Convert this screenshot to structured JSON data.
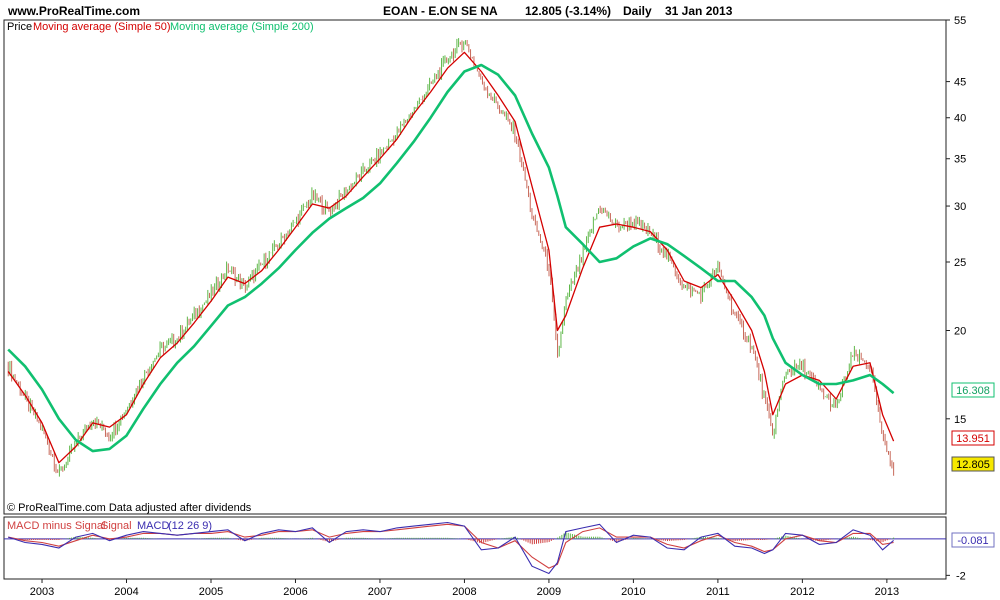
{
  "header": {
    "site": "www.ProRealTime.com",
    "instrument": "EOAN - E.ON SE NA",
    "last": "12.805 (-3.14%)",
    "period": "Daily",
    "date": "31 Jan 2013"
  },
  "price_panel": {
    "legend_price": "Price",
    "legend_ma50": "Moving average (Simple 50)",
    "legend_ma200": "Moving average (Simple 200)",
    "footer": "© ProRealTime.com  Data adjusted after dividends",
    "badges": {
      "ma200": "16.308",
      "ma50": "13.951",
      "price": "12.805"
    }
  },
  "macd_panel": {
    "legend_hist": "MACD minus Signal",
    "legend_signal": "Signal",
    "legend_macd": "MACD",
    "legend_params": "(12 26 9)",
    "badge": "-0.081"
  },
  "colors": {
    "candle_up": "#5fb84a",
    "candle_down": "#c8695a",
    "ma50": "#d40000",
    "ma200": "#10c070",
    "macd": "#3a2db0",
    "signal": "#d04040",
    "price_badge": "#f6e800",
    "zero_line": "#3a2db0"
  },
  "chart_data": [
    {
      "type": "line",
      "title": "EOAN - E.ON SE NA",
      "scale": "log",
      "ylim": [
        11,
        55
      ],
      "y_ticks": [
        15,
        20,
        25,
        30,
        35,
        40,
        45,
        55
      ],
      "x_ticks": [
        "2003",
        "2004",
        "2005",
        "2006",
        "2007",
        "2008",
        "2009",
        "2010",
        "2011",
        "2012",
        "2013"
      ],
      "x": [
        2002.6,
        2002.8,
        2003.0,
        2003.2,
        2003.4,
        2003.6,
        2003.8,
        2004.0,
        2004.2,
        2004.4,
        2004.6,
        2004.8,
        2005.0,
        2005.2,
        2005.4,
        2005.6,
        2005.8,
        2006.0,
        2006.2,
        2006.4,
        2006.6,
        2006.8,
        2007.0,
        2007.2,
        2007.4,
        2007.6,
        2007.8,
        2008.0,
        2008.2,
        2008.4,
        2008.6,
        2008.8,
        2009.0,
        2009.1,
        2009.2,
        2009.4,
        2009.6,
        2009.8,
        2010.0,
        2010.2,
        2010.4,
        2010.6,
        2010.8,
        2011.0,
        2011.2,
        2011.4,
        2011.55,
        2011.65,
        2011.8,
        2012.0,
        2012.2,
        2012.4,
        2012.6,
        2012.8,
        2012.95,
        2013.08
      ],
      "series": [
        {
          "name": "Price",
          "values": [
            17.8,
            16.0,
            14.5,
            12.5,
            13.8,
            15.0,
            14.2,
            15.5,
            17.2,
            18.8,
            19.5,
            21.0,
            22.5,
            24.5,
            23.0,
            24.8,
            26.5,
            28.5,
            31.0,
            29.5,
            31.5,
            33.5,
            35.5,
            38.0,
            41.0,
            44.5,
            48.5,
            51.5,
            45.0,
            41.5,
            38.0,
            29.0,
            24.5,
            18.2,
            22.0,
            25.5,
            30.0,
            28.0,
            28.5,
            27.5,
            25.5,
            23.0,
            22.5,
            24.5,
            21.0,
            19.0,
            16.0,
            14.2,
            17.5,
            17.8,
            16.5,
            15.5,
            18.5,
            17.8,
            14.0,
            12.8
          ]
        },
        {
          "name": "Moving average (Simple 50)",
          "values": [
            17.5,
            16.2,
            14.8,
            13.0,
            13.7,
            14.8,
            14.6,
            15.2,
            16.8,
            18.3,
            19.2,
            20.5,
            22.0,
            23.8,
            23.3,
            24.3,
            26.0,
            28.0,
            30.2,
            29.8,
            31.0,
            33.0,
            35.0,
            37.3,
            40.5,
            43.5,
            47.0,
            49.5,
            46.5,
            43.0,
            39.5,
            32.0,
            26.0,
            20.0,
            21.0,
            24.5,
            28.0,
            28.3,
            28.0,
            27.6,
            26.0,
            23.5,
            23.0,
            24.0,
            22.0,
            20.0,
            17.5,
            15.2,
            16.8,
            17.3,
            17.0,
            16.0,
            17.8,
            18.0,
            15.2,
            13.951
          ]
        },
        {
          "name": "Moving average (Simple 200)",
          "values": [
            18.8,
            17.8,
            16.5,
            15.0,
            14.0,
            13.5,
            13.6,
            14.2,
            15.5,
            16.8,
            18.0,
            19.0,
            20.3,
            21.7,
            22.3,
            23.3,
            24.5,
            26.0,
            27.5,
            28.8,
            29.8,
            30.8,
            32.3,
            34.5,
            37.0,
            40.0,
            43.5,
            46.5,
            47.5,
            46.0,
            43.0,
            38.0,
            34.0,
            31.0,
            28.0,
            26.5,
            25.0,
            25.3,
            26.3,
            27.0,
            26.5,
            25.5,
            24.5,
            23.5,
            23.5,
            22.3,
            21.0,
            19.5,
            18.0,
            17.3,
            16.8,
            16.8,
            17.0,
            17.3,
            16.8,
            16.308
          ]
        }
      ]
    },
    {
      "type": "line",
      "title": "MACD (12 26 9)",
      "ylim": [
        -2.2,
        1.2
      ],
      "y_ticks": [
        -2
      ],
      "x": [
        2002.6,
        2002.8,
        2003.0,
        2003.2,
        2003.4,
        2003.6,
        2003.8,
        2004.0,
        2004.2,
        2004.4,
        2004.6,
        2004.8,
        2005.0,
        2005.2,
        2005.4,
        2005.6,
        2005.8,
        2006.0,
        2006.2,
        2006.4,
        2006.6,
        2006.8,
        2007.0,
        2007.2,
        2007.4,
        2007.6,
        2007.8,
        2008.0,
        2008.2,
        2008.4,
        2008.6,
        2008.8,
        2009.0,
        2009.1,
        2009.2,
        2009.4,
        2009.6,
        2009.8,
        2010.0,
        2010.2,
        2010.4,
        2010.6,
        2010.8,
        2011.0,
        2011.2,
        2011.4,
        2011.55,
        2011.65,
        2011.8,
        2012.0,
        2012.2,
        2012.4,
        2012.6,
        2012.8,
        2012.95,
        2013.08
      ],
      "series": [
        {
          "name": "MACD",
          "values": [
            0.1,
            -0.2,
            -0.3,
            -0.5,
            0.1,
            0.3,
            -0.1,
            0.2,
            0.4,
            0.3,
            0.2,
            0.3,
            0.4,
            0.5,
            -0.1,
            0.3,
            0.5,
            0.4,
            0.6,
            -0.2,
            0.4,
            0.5,
            0.4,
            0.6,
            0.7,
            0.8,
            0.9,
            0.7,
            -0.6,
            -0.5,
            0.1,
            -1.5,
            -1.9,
            -1.3,
            0.4,
            0.6,
            0.8,
            -0.2,
            0.2,
            0.1,
            -0.5,
            -0.6,
            0.1,
            0.3,
            -0.4,
            -0.5,
            -0.8,
            -0.6,
            0.3,
            0.2,
            -0.3,
            -0.2,
            0.5,
            0.2,
            -0.6,
            -0.081
          ]
        },
        {
          "name": "Signal",
          "values": [
            0.1,
            -0.1,
            -0.2,
            -0.4,
            -0.1,
            0.2,
            0.0,
            0.1,
            0.3,
            0.3,
            0.2,
            0.3,
            0.3,
            0.4,
            0.1,
            0.2,
            0.4,
            0.4,
            0.5,
            0.1,
            0.3,
            0.4,
            0.4,
            0.5,
            0.6,
            0.7,
            0.8,
            0.7,
            -0.2,
            -0.5,
            -0.1,
            -1.0,
            -1.6,
            -1.4,
            -0.2,
            0.4,
            0.6,
            0.1,
            0.1,
            0.1,
            -0.3,
            -0.5,
            -0.1,
            0.2,
            -0.2,
            -0.4,
            -0.7,
            -0.6,
            0.0,
            0.2,
            -0.1,
            -0.2,
            0.3,
            0.3,
            -0.3,
            -0.2
          ]
        }
      ]
    }
  ]
}
